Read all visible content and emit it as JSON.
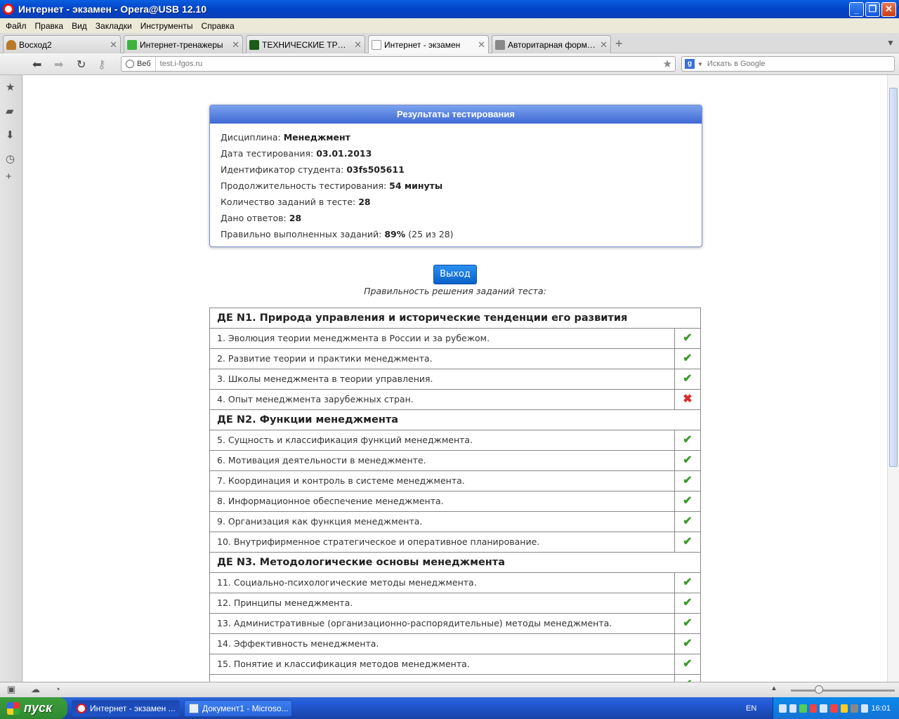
{
  "window": {
    "title": "Интернет - экзамен - Opera@USB 12.10"
  },
  "menu": [
    "Файл",
    "Правка",
    "Вид",
    "Закладки",
    "Инструменты",
    "Справка"
  ],
  "tabs": [
    {
      "label": "Восход2"
    },
    {
      "label": "Интернет-тренажеры"
    },
    {
      "label": "ТЕХНИЧЕСКИЕ ТРЕБОВА..."
    },
    {
      "label": "Интернет - экзамен"
    },
    {
      "label": "Авторитарная форма и..."
    }
  ],
  "address": {
    "scope": "Веб",
    "url": "test.i-fgos.ru"
  },
  "search": {
    "placeholder": "Искать в Google"
  },
  "results": {
    "title": "Результаты тестирования",
    "discipline_label": "Дисциплина: ",
    "discipline": "Менеджмент",
    "date_label": "Дата тестирования: ",
    "date": "03.01.2013",
    "student_label": "Идентификатор студента: ",
    "student": "03fs505611",
    "duration_label": "Продолжительность тестирования: ",
    "duration": "54 минуты",
    "count_label": "Количество заданий в тесте: ",
    "count": "28",
    "answered_label": "Дано ответов: ",
    "answered": "28",
    "correct_label": "Правильно выполненных заданий: ",
    "correct_pct": "89%",
    "correct_detail": " (25 из 28)"
  },
  "exit_label": "Выход",
  "caption": "Правильность решения заданий теста:",
  "sections": [
    {
      "title": "ДЕ N1. Природа управления и исторические тенденции его развития",
      "items": [
        {
          "text": "1. Эволюция теории менеджмента в России и за рубежом.",
          "ok": true
        },
        {
          "text": "2. Развитие теории и практики менеджмента.",
          "ok": true
        },
        {
          "text": "3. Школы менеджмента в теории управления.",
          "ok": true
        },
        {
          "text": "4. Опыт менеджмента зарубежных стран.",
          "ok": false
        }
      ]
    },
    {
      "title": "ДЕ N2. Функции менеджмента",
      "items": [
        {
          "text": "5. Сущность и классификация функций менеджмента.",
          "ok": true
        },
        {
          "text": "6. Мотивация деятельности в менеджменте.",
          "ok": true
        },
        {
          "text": "7. Координация и контроль в системе менеджмента.",
          "ok": true
        },
        {
          "text": "8. Информационное обеспечение менеджмента.",
          "ok": true
        },
        {
          "text": "9. Организация как функция менеджмента.",
          "ok": true
        },
        {
          "text": "10. Внутрифирменное стратегическое и оперативное планирование.",
          "ok": true
        }
      ]
    },
    {
      "title": "ДЕ N3. Методологические основы менеджмента",
      "items": [
        {
          "text": "11. Социально-психологические методы менеджмента.",
          "ok": true
        },
        {
          "text": "12. Принципы менеджмента.",
          "ok": true
        },
        {
          "text": "13. Административные (организационно-распорядительные) методы менеджмента.",
          "ok": true
        },
        {
          "text": "14. Эффективность менеджмента.",
          "ok": true
        },
        {
          "text": "15. Понятие и классификация методов менеджмента.",
          "ok": true
        }
      ]
    }
  ],
  "icons": {
    "ok": "✔",
    "bad": "✖"
  },
  "taskbar": {
    "start": "пуск",
    "buttons": [
      {
        "label": "Интернет - экзамен ..."
      },
      {
        "label": "Документ1 - Microso..."
      }
    ],
    "lang": "EN",
    "clock": "16:01"
  },
  "colors": {
    "header_blue": "#3e69d3",
    "ok_green": "#3a9a2a",
    "bad_red": "#e02828"
  }
}
